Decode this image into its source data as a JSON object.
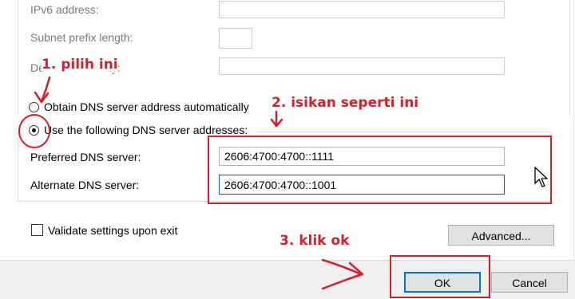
{
  "ipv6": {
    "address_label": "IPv6 address:",
    "address_value": "",
    "prefix_label": "Subnet prefix length:",
    "prefix_value": "",
    "gateway_label_partial": "De",
    "gateway_label_tail": "ay:",
    "gateway_value": ""
  },
  "dns": {
    "auto_radio_label": "Obtain DNS server address automatically",
    "manual_radio_label": "Use the following DNS server addresses:",
    "manual_selected": true,
    "preferred_label": "Preferred DNS server:",
    "preferred_value": "2606:4700:4700::1111",
    "alternate_label": "Alternate DNS server:",
    "alternate_value": "2606:4700:4700::1001"
  },
  "validate": {
    "label": "Validate settings upon exit",
    "checked": false
  },
  "buttons": {
    "advanced": "Advanced...",
    "ok": "OK",
    "cancel": "Cancel"
  },
  "annotations": {
    "step1": "1. pilih ini",
    "step2": "2. isikan seperti ini",
    "step3": "3. klik ok",
    "color": "#d3212c"
  }
}
